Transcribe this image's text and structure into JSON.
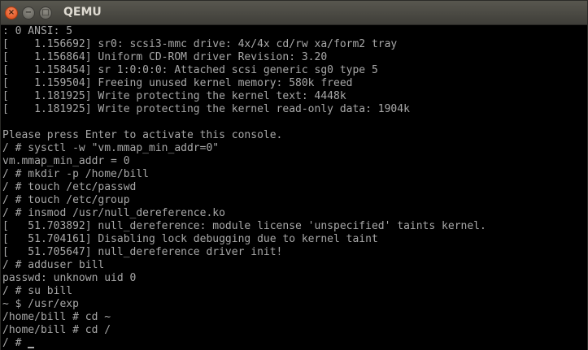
{
  "window": {
    "title": "QEMU",
    "close_glyph": "×",
    "minimize_glyph": "−",
    "maximize_glyph": "□"
  },
  "terminal": {
    "lines": [
      ": 0 ANSI: 5",
      "[    1.156692] sr0: scsi3-mmc drive: 4x/4x cd/rw xa/form2 tray",
      "[    1.156864] Uniform CD-ROM driver Revision: 3.20",
      "[    1.158454] sr 1:0:0:0: Attached scsi generic sg0 type 5",
      "[    1.159504] Freeing unused kernel memory: 580k freed",
      "[    1.181925] Write protecting the kernel text: 4448k",
      "[    1.181925] Write protecting the kernel read-only data: 1904k",
      "",
      "Please press Enter to activate this console.",
      "/ # sysctl -w \"vm.mmap_min_addr=0\"",
      "vm.mmap_min_addr = 0",
      "/ # mkdir -p /home/bill",
      "/ # touch /etc/passwd",
      "/ # touch /etc/group",
      "/ # insmod /usr/null_dereference.ko",
      "[   51.703892] null_dereference: module license 'unspecified' taints kernel.",
      "[   51.704161] Disabling lock debugging due to kernel taint",
      "[   51.705647] null_dereference driver init!",
      "/ # adduser bill",
      "passwd: unknown uid 0",
      "/ # su bill",
      "~ $ /usr/exp",
      "/home/bill # cd ~",
      "/home/bill # cd /",
      "/ # "
    ]
  }
}
